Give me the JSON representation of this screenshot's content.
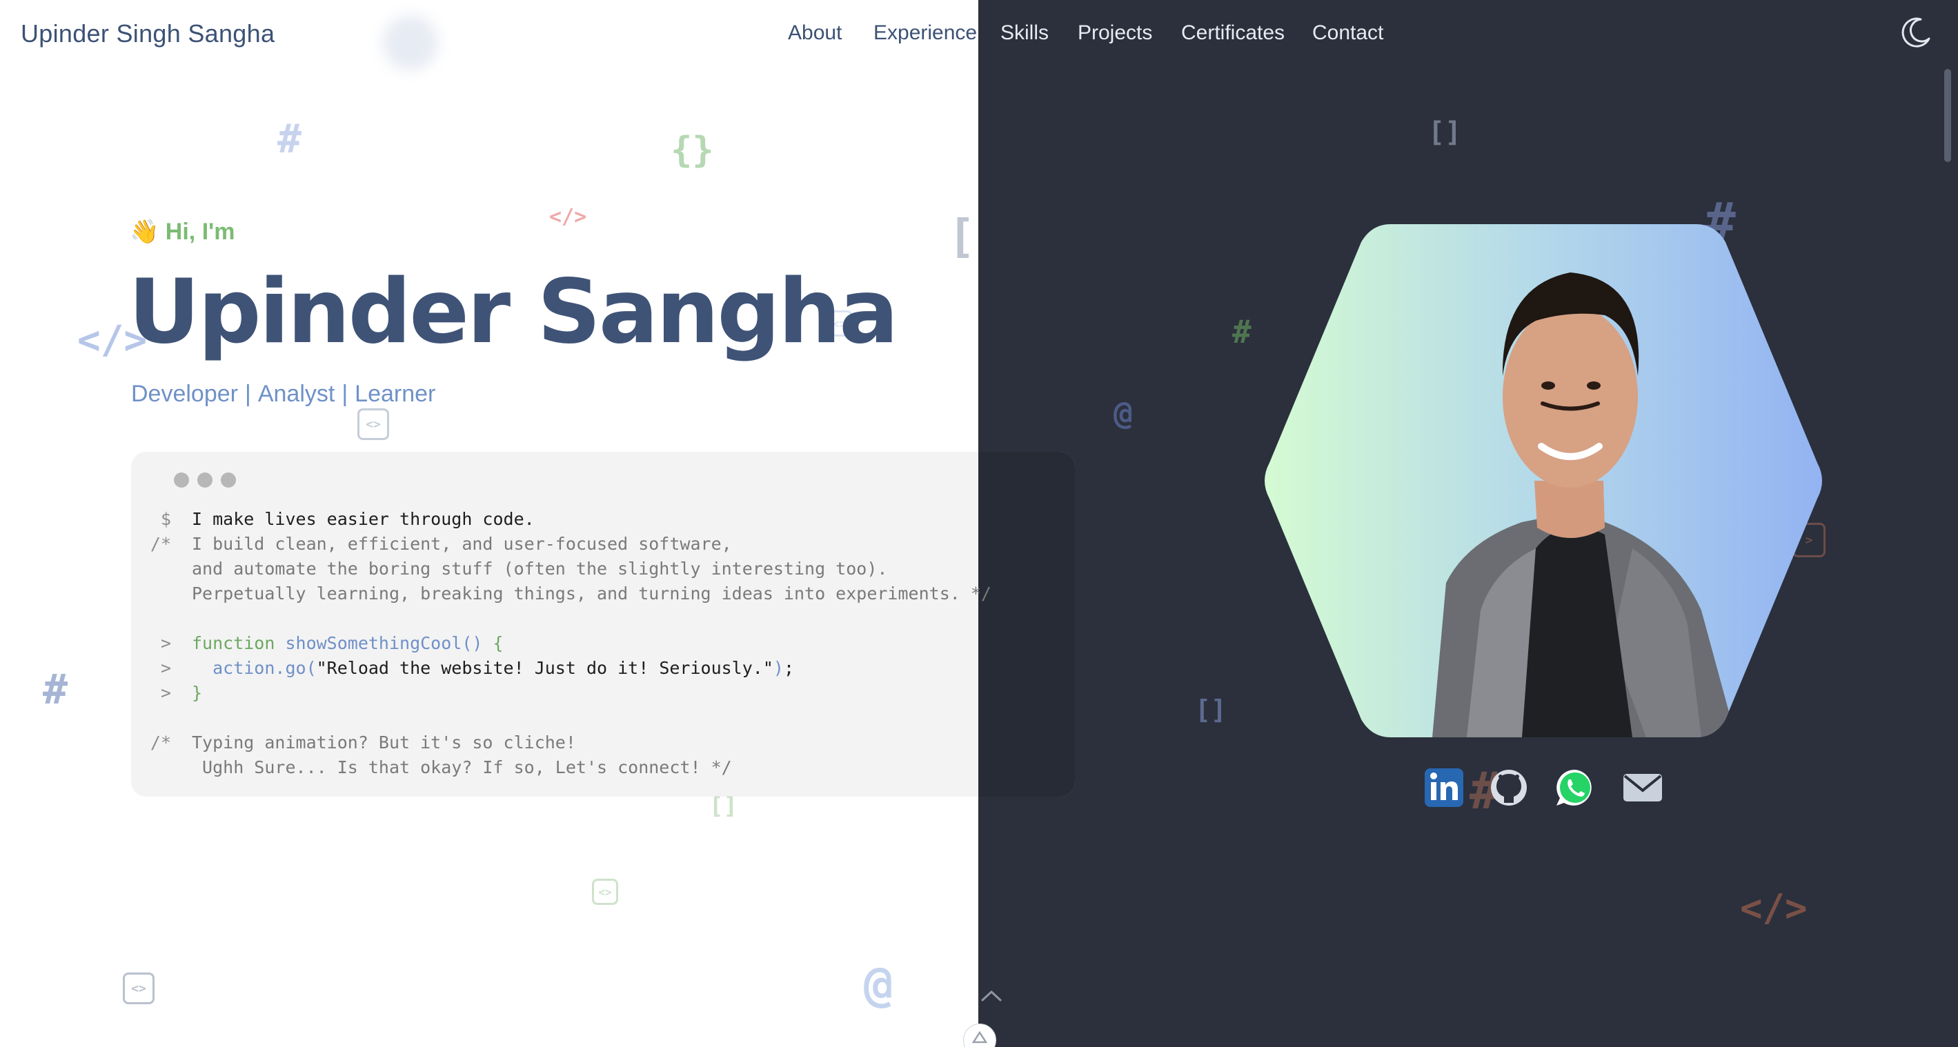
{
  "header": {
    "brand": "Upinder Singh Sangha",
    "nav": [
      {
        "label": "About"
      },
      {
        "label": "Experience"
      },
      {
        "label": "Skills"
      },
      {
        "label": "Projects"
      },
      {
        "label": "Certificates"
      },
      {
        "label": "Contact"
      }
    ],
    "theme_toggle_icon": "moon-icon"
  },
  "hero": {
    "greeting_emoji": "👋",
    "greeting": "Hi, I'm",
    "name": "Upinder Sangha",
    "roles": [
      "Developer",
      "Analyst",
      "Learner"
    ],
    "role_separator": "|"
  },
  "terminal": {
    "lines": [
      {
        "gutter": "$",
        "segments": [
          {
            "t": "I make lives easier through code.",
            "c": "plain"
          }
        ]
      },
      {
        "gutter": "/*",
        "segments": [
          {
            "t": "I build clean, efficient, and user-focused software,",
            "c": "cmt"
          }
        ]
      },
      {
        "gutter": "",
        "segments": [
          {
            "t": "and automate the boring stuff (often the slightly interesting too).",
            "c": "cmt"
          }
        ]
      },
      {
        "gutter": "",
        "segments": [
          {
            "t": "Perpetually learning, breaking things, and turning ideas into experiments. */",
            "c": "cmt"
          }
        ]
      },
      {
        "gutter": "",
        "segments": []
      },
      {
        "gutter": ">",
        "segments": [
          {
            "t": "function ",
            "c": "kw"
          },
          {
            "t": "showSomethingCool()",
            "c": "fn"
          },
          {
            "t": " {",
            "c": "kw"
          }
        ]
      },
      {
        "gutter": ">",
        "segments": [
          {
            "t": "  action.go(",
            "c": "fn"
          },
          {
            "t": "\"Reload the website! Just do it! Seriously.\"",
            "c": "plain"
          },
          {
            "t": ")",
            "c": "fn"
          },
          {
            "t": ";",
            "c": "plain"
          }
        ]
      },
      {
        "gutter": ">",
        "segments": [
          {
            "t": "}",
            "c": "kw"
          }
        ]
      },
      {
        "gutter": "",
        "segments": []
      },
      {
        "gutter": "/*",
        "segments": [
          {
            "t": "Typing animation? But it's so cliche!",
            "c": "cmt"
          }
        ]
      },
      {
        "gutter": "",
        "segments": [
          {
            "t": " Ughh Sure... Is that okay? If so, Let's connect! */",
            "c": "cmt"
          }
        ]
      }
    ]
  },
  "socials": [
    {
      "name": "linkedin-icon",
      "color": "#2867b2"
    },
    {
      "name": "github-icon",
      "color": "#d8dde6"
    },
    {
      "name": "whatsapp-icon",
      "color": "#25d366"
    },
    {
      "name": "email-icon",
      "color": "#c9d1dc"
    }
  ],
  "colors": {
    "dark_bg": "#2b303c",
    "heading": "#3f5377",
    "accent_green": "#7cbb73",
    "accent_blue": "#6f91c8"
  }
}
